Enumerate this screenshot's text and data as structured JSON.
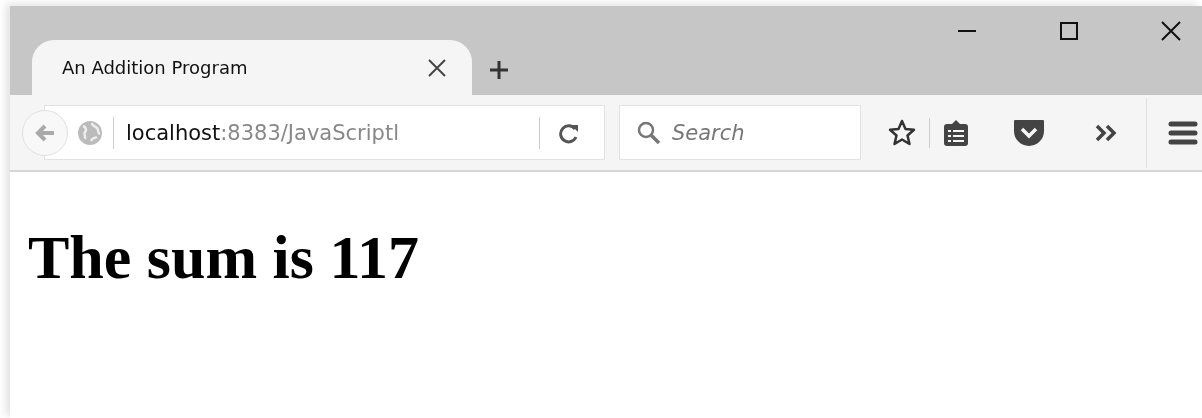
{
  "window": {
    "tabs": [
      {
        "title": "An Addition Program",
        "selected": true
      }
    ]
  },
  "address_bar": {
    "host": "localhost",
    "path": ":8383/JavaScriptl"
  },
  "search": {
    "placeholder": "Search"
  },
  "page": {
    "heading": "The sum is 117"
  }
}
